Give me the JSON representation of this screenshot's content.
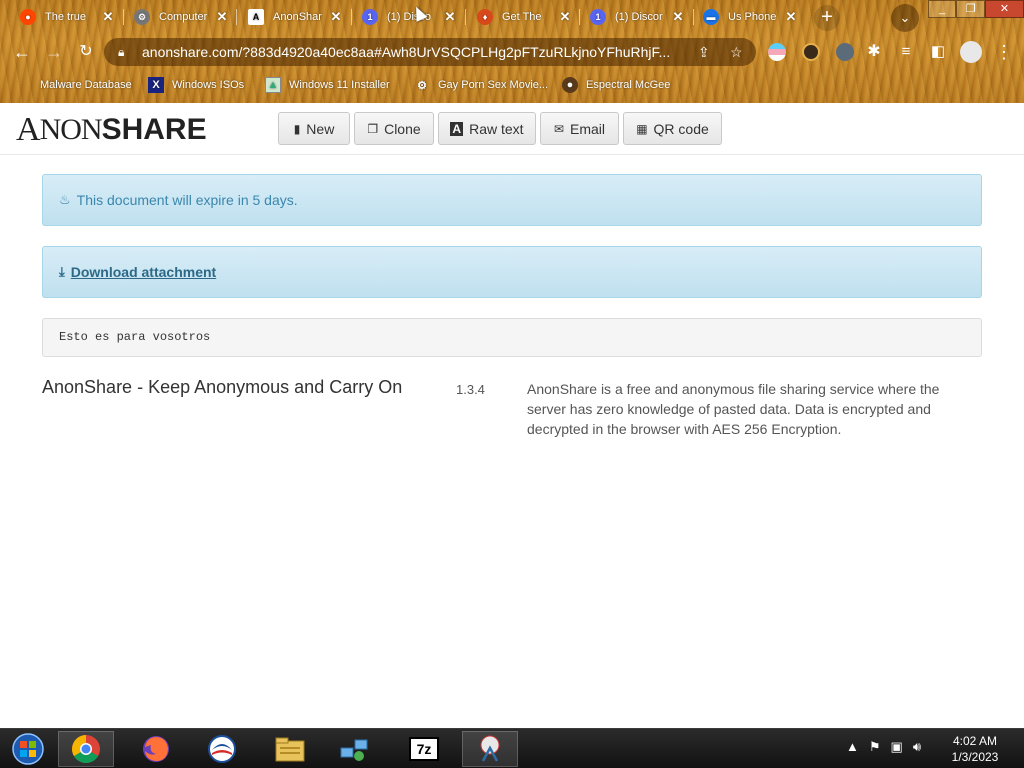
{
  "browser": {
    "tabs": [
      {
        "title": "The true",
        "favicon": "reddit-icon",
        "color": "#ff4500"
      },
      {
        "title": "Computer",
        "favicon": "gear-icon",
        "color": "#666666"
      },
      {
        "title": "AnonShar",
        "favicon": "anonshare-icon",
        "color": "#ffffff"
      },
      {
        "title": "(1) Disco",
        "favicon": "discord-icon",
        "color": "#5865f2"
      },
      {
        "title": "Get The",
        "favicon": "fire-icon",
        "color": "#d9481b"
      },
      {
        "title": "(1) Discor",
        "favicon": "discord-icon",
        "color": "#5865f2"
      },
      {
        "title": "Us Phone",
        "favicon": "chat-icon",
        "color": "#1a73e8"
      }
    ],
    "window_controls": [
      "_",
      "❐",
      "✕"
    ],
    "url": "anonshare.com/?883d4920a40ec8aa#Awh8UrVSQCPLHg2pFTzuRLkjnoYFhuRhjF...",
    "bookmarks": [
      {
        "label": "Malware Database",
        "icon": "bookmark-icon"
      },
      {
        "label": "Windows ISOs",
        "icon": "x-icon"
      },
      {
        "label": "Windows 11 Installer",
        "icon": "image-icon"
      },
      {
        "label": "Gay Porn Sex Movie...",
        "icon": "gear-icon"
      },
      {
        "label": "Espectral McGee",
        "icon": "avatar-icon"
      }
    ]
  },
  "page": {
    "logo": {
      "a": "A",
      "non": "NON",
      "share": "SHARE"
    },
    "toolbar": [
      {
        "label": "New",
        "icon": "file-icon",
        "glyph": "▮"
      },
      {
        "label": "Clone",
        "icon": "copy-icon",
        "glyph": "❐"
      },
      {
        "label": "Raw text",
        "icon": "font-icon",
        "glyph": "A"
      },
      {
        "label": "Email",
        "icon": "envelope-icon",
        "glyph": "✉"
      },
      {
        "label": "QR code",
        "icon": "qrcode-icon",
        "glyph": "▦"
      }
    ],
    "expire_notice": "This document will expire in 5 days.",
    "download_label": "Download attachment",
    "document_text": "Esto es para vosotros",
    "footer": {
      "title": "AnonShare - Keep Anonymous and Carry On",
      "version": "1.3.4",
      "about": "AnonShare is a free and anonymous file sharing service where the server has zero knowledge of pasted data. Data is encrypted and decrypted in the browser with AES 256 Encryption."
    }
  },
  "taskbar": {
    "apps": [
      "windows-start-icon",
      "chrome-icon",
      "firefox-icon",
      "obama-icon",
      "file-explorer-icon",
      "network-icon",
      "7zip-icon",
      "snipping-tool-icon"
    ],
    "seven_zip_label": "7z",
    "time": "4:02 AM",
    "date": "1/3/2023"
  }
}
